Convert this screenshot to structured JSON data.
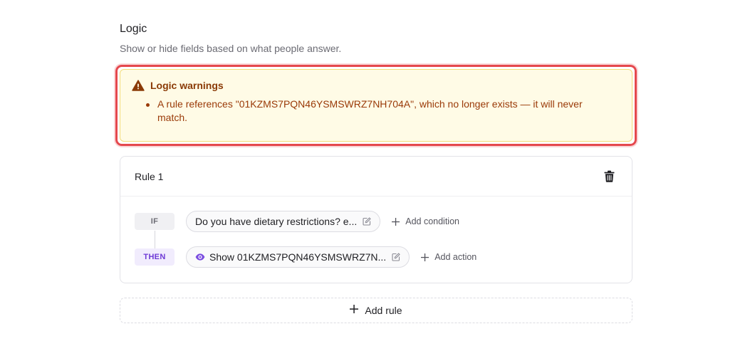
{
  "logic": {
    "title": "Logic",
    "subtitle": "Show or hide fields based on what people answer."
  },
  "warnings": {
    "title": "Logic warnings",
    "items": [
      "A rule references \"01KZMS7PQN46YSMSWRZ7NH704A\", which no longer exists — it will never match."
    ]
  },
  "rules": [
    {
      "title": "Rule 1",
      "if_label": "IF",
      "then_label": "THEN",
      "condition_text": "Do you have dietary restrictions? e...",
      "action_text": "Show 01KZMS7PQN46YSMSWRZ7N...",
      "add_condition_label": "Add condition",
      "add_action_label": "Add action"
    }
  ],
  "add_rule_label": "Add rule",
  "colors": {
    "warning_accent": "#8a3a06",
    "error_border": "#e5484d",
    "then_accent": "#6e3ad6"
  },
  "icons": {
    "warning": "warning-triangle-icon",
    "delete": "trash-icon",
    "edit": "edit-icon",
    "visibility": "eye-icon",
    "add": "plus-icon"
  }
}
